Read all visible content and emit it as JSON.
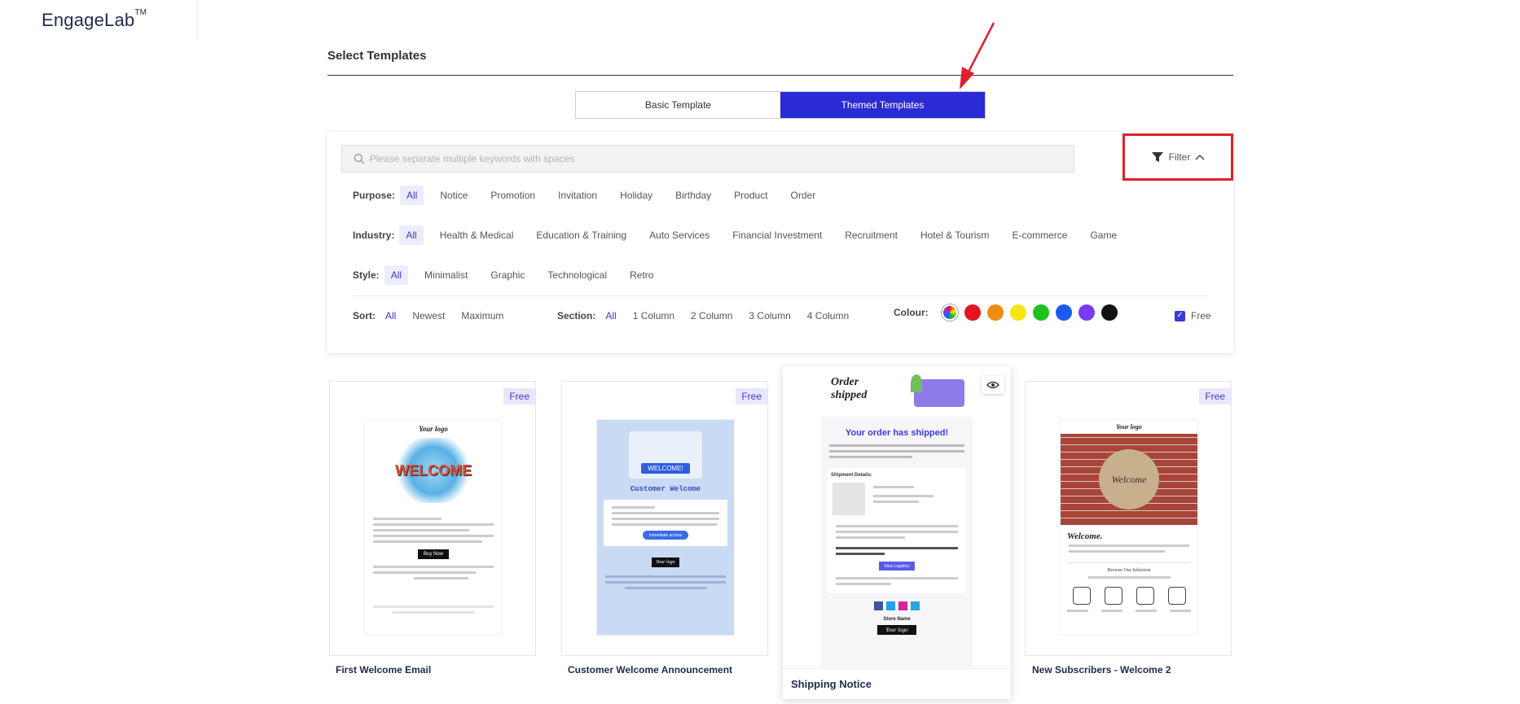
{
  "logo": {
    "text": "EngageLab",
    "tm": "TM"
  },
  "page_title": "Select Templates",
  "tabs": [
    {
      "label": "Basic Template",
      "active": false
    },
    {
      "label": "Themed Templates",
      "active": true
    }
  ],
  "search": {
    "placeholder": "Please separate multiple keywords with spaces"
  },
  "filter": {
    "label": "Filter"
  },
  "purpose": {
    "label": "Purpose:",
    "options": [
      "All",
      "Notice",
      "Promotion",
      "Invitation",
      "Holiday",
      "Birthday",
      "Product",
      "Order"
    ]
  },
  "industry": {
    "label": "Industry:",
    "options": [
      "All",
      "Health & Medical",
      "Education & Training",
      "Auto Services",
      "Financial Investment",
      "Recruitment",
      "Hotel & Tourism",
      "E-commerce",
      "Game"
    ]
  },
  "style": {
    "label": "Style:",
    "options": [
      "All",
      "Minimalist",
      "Graphic",
      "Technological",
      "Retro"
    ]
  },
  "sort": {
    "label": "Sort:",
    "options": [
      "All",
      "Newest",
      "Maximum"
    ]
  },
  "section": {
    "label": "Section:",
    "options": [
      "All",
      "1 Column",
      "2 Column",
      "3 Column",
      "4 Column"
    ]
  },
  "colour": {
    "label": "Colour:",
    "swatches": [
      "#e6141e",
      "#f08c14",
      "#f5e614",
      "#1ec31e",
      "#1e5af0",
      "#7a3cf0",
      "#111111"
    ]
  },
  "free_filter": {
    "label": "Free",
    "checked": true
  },
  "cards": [
    {
      "title": "First Welcome Email",
      "badge": "Free",
      "preview": {
        "logo": "Your logo",
        "hero": "WELCOME",
        "cta": "Buy Now"
      }
    },
    {
      "title": "Customer Welcome Announcement",
      "badge": "Free",
      "preview": {
        "banner": "WELCOME!",
        "heading": "Customer Welcome",
        "cta": "Immediate access",
        "logo": "Your logo"
      }
    },
    {
      "title": "Shipping Notice",
      "preview": {
        "hero": "Order shipped",
        "heading": "Your order has shipped!",
        "details": "Shipment Details:",
        "cta": "View Logistics",
        "store": "Store Name",
        "logo": "Your logo"
      }
    },
    {
      "title": "New Subscribers - Welcome 2",
      "badge": "Free",
      "preview": {
        "logo": "Your logo",
        "sign": "Welcome",
        "heading": "Welcome.",
        "section": "Browse Our Selection"
      }
    }
  ],
  "colors": {
    "accent": "#2b2bd6",
    "highlight": "#e0202a"
  }
}
